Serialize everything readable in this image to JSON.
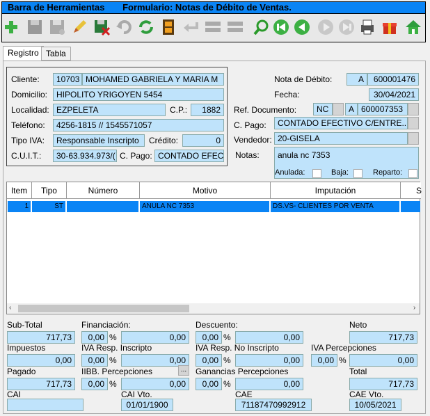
{
  "title": {
    "section": "Barra de Herramientas",
    "form": "Formulario: Notas de Débito de Ventas."
  },
  "toolbar": {
    "icons": [
      "add-icon",
      "save-icon",
      "save-disabled-icon",
      "edit-icon",
      "save-close-icon",
      "undo-icon",
      "refresh-icon",
      "film-icon",
      "back-arrow-icon",
      "list-icon",
      "list2-icon",
      "search-icon",
      "first-icon",
      "previous-icon",
      "next-icon",
      "last-icon",
      "print-icon",
      "gift-icon",
      "home-icon"
    ]
  },
  "tabs": [
    {
      "label": "Registro"
    },
    {
      "label": "Tabla"
    }
  ],
  "client": {
    "cliente_label": "Cliente:",
    "cliente_code": "10703",
    "cliente_name": "MOHAMED GABRIELA Y MARIA M",
    "domicilio_label": "Domicilio:",
    "domicilio": "HIPOLITO YRIGOYEN 5454",
    "localidad_label": "Localidad:",
    "localidad": "EZPELETA",
    "cp_label": "C.P.:",
    "cp": "1882",
    "telefono_label": "Teléfono:",
    "telefono": "4256-1815 // 1545571057",
    "tipo_iva_label": "Tipo IVA:",
    "tipo_iva": "Responsable Inscripto",
    "credito_label": "Crédito:",
    "credito": "0",
    "cuit_label": "C.U.I.T.:",
    "cuit": "30-63.934.973/(",
    "cpago_label": "C. Pago:",
    "cpago": "CONTADO EFEC"
  },
  "doc": {
    "nota_label": "Nota de Débito:",
    "nota_letter": "A",
    "nota_number": "600001476",
    "fecha_label": "Fecha:",
    "fecha": "30/04/2021",
    "ref_label": "Ref. Documento:",
    "ref_type": "NC",
    "ref_letter": "A",
    "ref_number": "600007353",
    "cpago_label": "C. Pago:",
    "cpago": "CONTADO EFECTIVO C/ENTRE...",
    "vendedor_label": "Vendedor:",
    "vendedor": "20-GISELA",
    "notas_label": "Notas:",
    "notas": "anula nc 7353",
    "anulada_label": "Anulada:",
    "baja_label": "Baja:",
    "reparto_label": "Reparto:"
  },
  "grid": {
    "headers": [
      "Item",
      "Tipo",
      "Número",
      "Motivo",
      "Imputación",
      "S"
    ],
    "rows": [
      {
        "item": "1",
        "tipo": "ST",
        "numero": "",
        "motivo": "ANULA NC 7353",
        "imputacion": "DS.VS- CLIENTES POR VENTA"
      }
    ]
  },
  "totals": {
    "subtotal_label": "Sub-Total",
    "subtotal": "717,73",
    "financiacion_label": "Financiación:",
    "financiacion_pct": "0,00",
    "financiacion": "0,00",
    "descuento_label": "Descuento:",
    "descuento_pct": "0,00",
    "descuento": "0,00",
    "neto_label": "Neto",
    "neto": "717,73",
    "impuestos_label": "Impuestos",
    "impuestos": "0,00",
    "iva_ri_label": "IVA Resp. Inscripto",
    "iva_ri_pct": "0,00",
    "iva_ri": "0,00",
    "iva_rni_label": "IVA Resp. No Inscripto",
    "iva_rni_pct": "0,00",
    "iva_rni": "0,00",
    "iva_perc_label": "IVA Percepciones",
    "iva_perc_pct": "0,00",
    "iva_perc": "0,00",
    "pagado_label": "Pagado",
    "pagado": "717,73",
    "iibb_label": "IIBB. Percepciones",
    "iibb_pct": "0,00",
    "iibb": "0,00",
    "iibb_btn": "...",
    "ganancias_label": "Ganancias Percepciones",
    "ganancias_pct": "0,00",
    "ganancias": "0,00",
    "total_label": "Total",
    "total": "717,73",
    "cai_label": "CAI",
    "cai": "",
    "cai_vto_label": "CAI Vto.",
    "cai_vto": "01/01/1900",
    "cae_label": "CAE",
    "cae": "71187470992912",
    "cae_vto_label": "CAE Vto.",
    "cae_vto": "10/05/2021",
    "pct_sign": "%"
  }
}
